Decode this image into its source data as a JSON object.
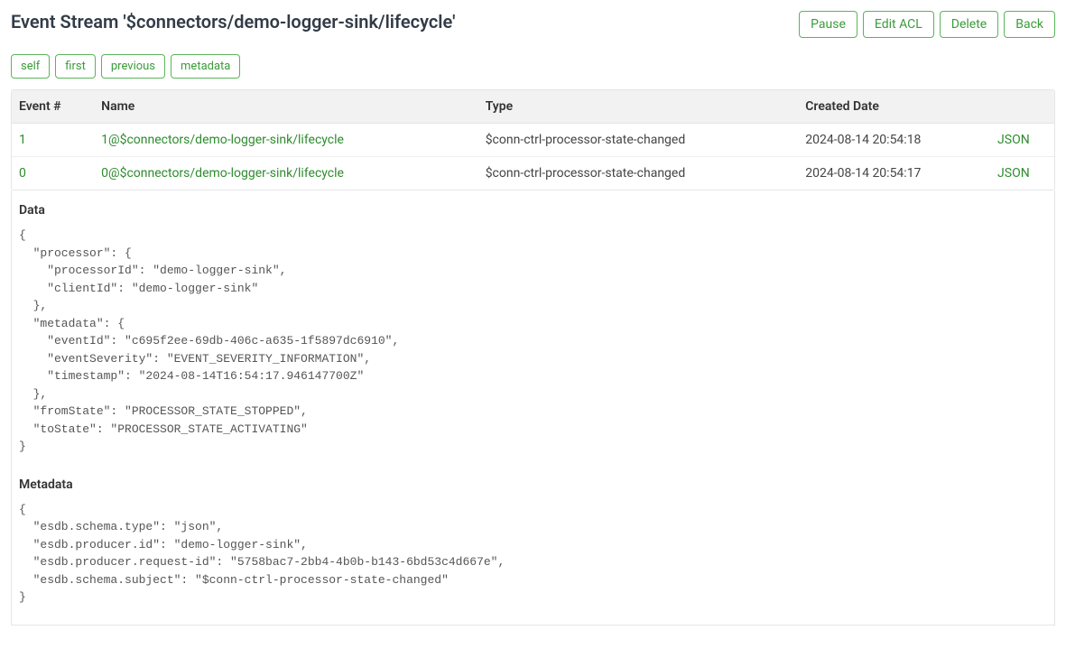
{
  "header": {
    "title": "Event Stream '$connectors/demo-logger-sink/lifecycle'",
    "actions": {
      "pause": "Pause",
      "edit_acl": "Edit ACL",
      "delete": "Delete",
      "back": "Back"
    }
  },
  "nav": {
    "self": "self",
    "first": "first",
    "previous": "previous",
    "metadata": "metadata"
  },
  "table": {
    "headers": {
      "event_no": "Event #",
      "name": "Name",
      "type": "Type",
      "created_date": "Created Date",
      "json_col": ""
    },
    "rows": [
      {
        "event_no": "1",
        "name": "1@$connectors/demo-logger-sink/lifecycle",
        "type": "$conn-ctrl-processor-state-changed",
        "created_date": "2024-08-14 20:54:18",
        "json": "JSON"
      },
      {
        "event_no": "0",
        "name": "0@$connectors/demo-logger-sink/lifecycle",
        "type": "$conn-ctrl-processor-state-changed",
        "created_date": "2024-08-14 20:54:17",
        "json": "JSON"
      }
    ]
  },
  "detail": {
    "data_heading": "Data",
    "data_body": "{\n  \"processor\": {\n    \"processorId\": \"demo-logger-sink\",\n    \"clientId\": \"demo-logger-sink\"\n  },\n  \"metadata\": {\n    \"eventId\": \"c695f2ee-69db-406c-a635-1f5897dc6910\",\n    \"eventSeverity\": \"EVENT_SEVERITY_INFORMATION\",\n    \"timestamp\": \"2024-08-14T16:54:17.946147700Z\"\n  },\n  \"fromState\": \"PROCESSOR_STATE_STOPPED\",\n  \"toState\": \"PROCESSOR_STATE_ACTIVATING\"\n}",
    "metadata_heading": "Metadata",
    "metadata_body": "{\n  \"esdb.schema.type\": \"json\",\n  \"esdb.producer.id\": \"demo-logger-sink\",\n  \"esdb.producer.request-id\": \"5758bac7-2bb4-4b0b-b143-6bd53c4d667e\",\n  \"esdb.schema.subject\": \"$conn-ctrl-processor-state-changed\"\n}"
  }
}
